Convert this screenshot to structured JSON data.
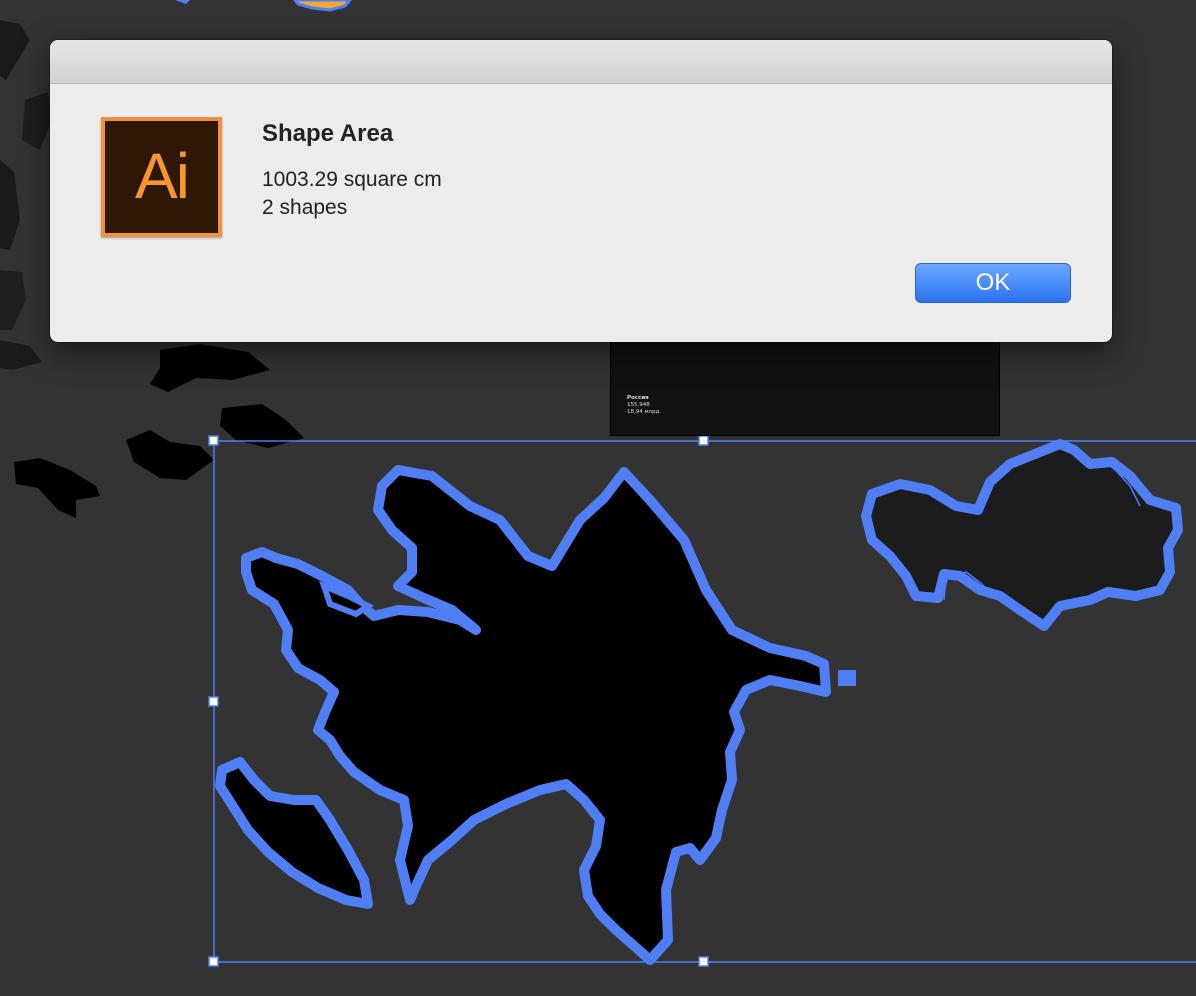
{
  "dialog": {
    "app_icon_label": "Ai",
    "title": "Shape Area",
    "area_text": "1003.29 square cm",
    "shapes_text": "2 shapes",
    "ok_label": "OK"
  },
  "artboard_caption": {
    "line1": "Россия",
    "line2": "155,948",
    "line3": "18,94 млрд."
  },
  "colors": {
    "canvas_background": "#333333",
    "selection_blue": "#4f7ef5",
    "dialog_background": "#ececec",
    "button_blue": "#2a73f0",
    "illustrator_orange": "#f2913b"
  }
}
